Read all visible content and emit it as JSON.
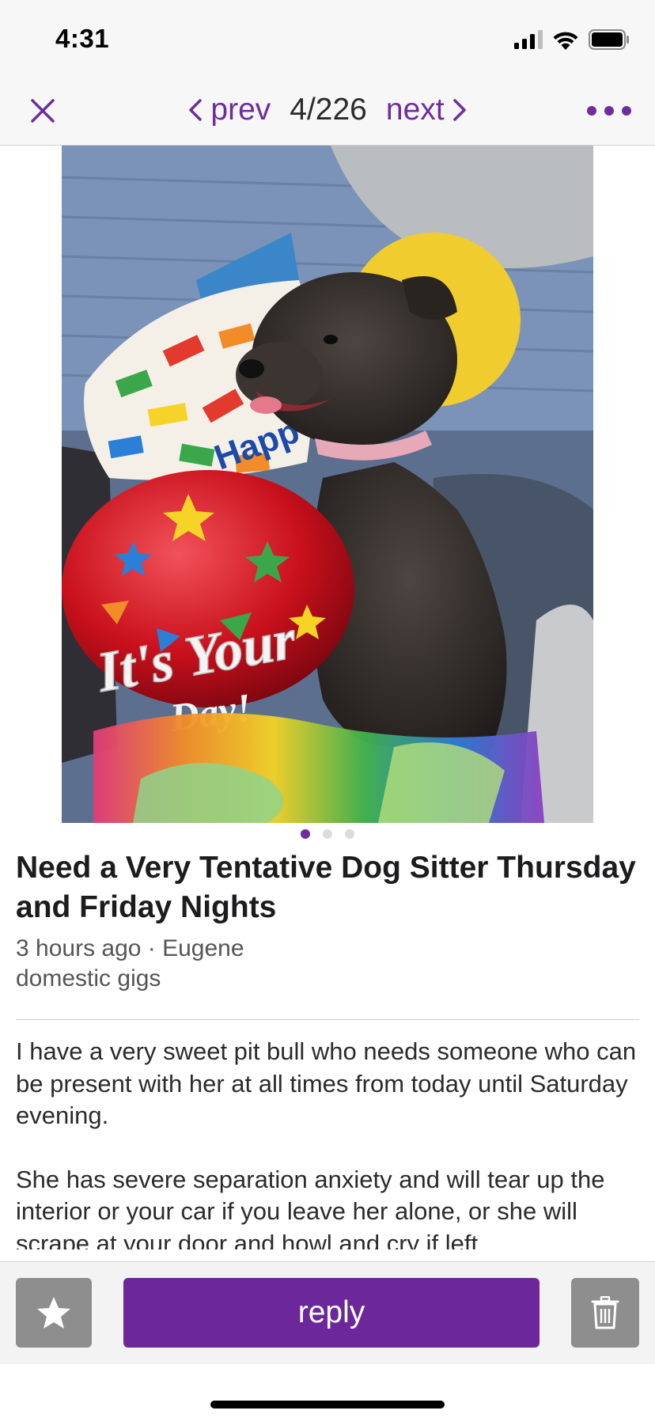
{
  "status_bar": {
    "time": "4:31"
  },
  "nav": {
    "prev_label": "prev",
    "counter": "4/226",
    "next_label": "next"
  },
  "photo": {
    "balloon_text": "It's Your",
    "balloon_text_2": "Day!",
    "balloon_text_3": "Happ",
    "carousel_count": 3,
    "carousel_active_index": 0
  },
  "post": {
    "title": "Need a Very Tentative Dog Sitter Thursday and Friday Nights",
    "meta": "3 hours ago · Eugene",
    "category": "domestic gigs",
    "paragraphs": [
      "I have a very sweet pit bull who needs someone who can be present with her at all times from today until Saturday evening.",
      "She has severe separation anxiety and will tear up the interior or your car if you leave her alone, or she will scrape at your door and howl and cry if left"
    ]
  },
  "actions": {
    "reply_label": "reply"
  },
  "colors": {
    "accent": "#6f2c9f",
    "reply_button": "#6c279b",
    "secondary_button": "#8e8e8e"
  }
}
